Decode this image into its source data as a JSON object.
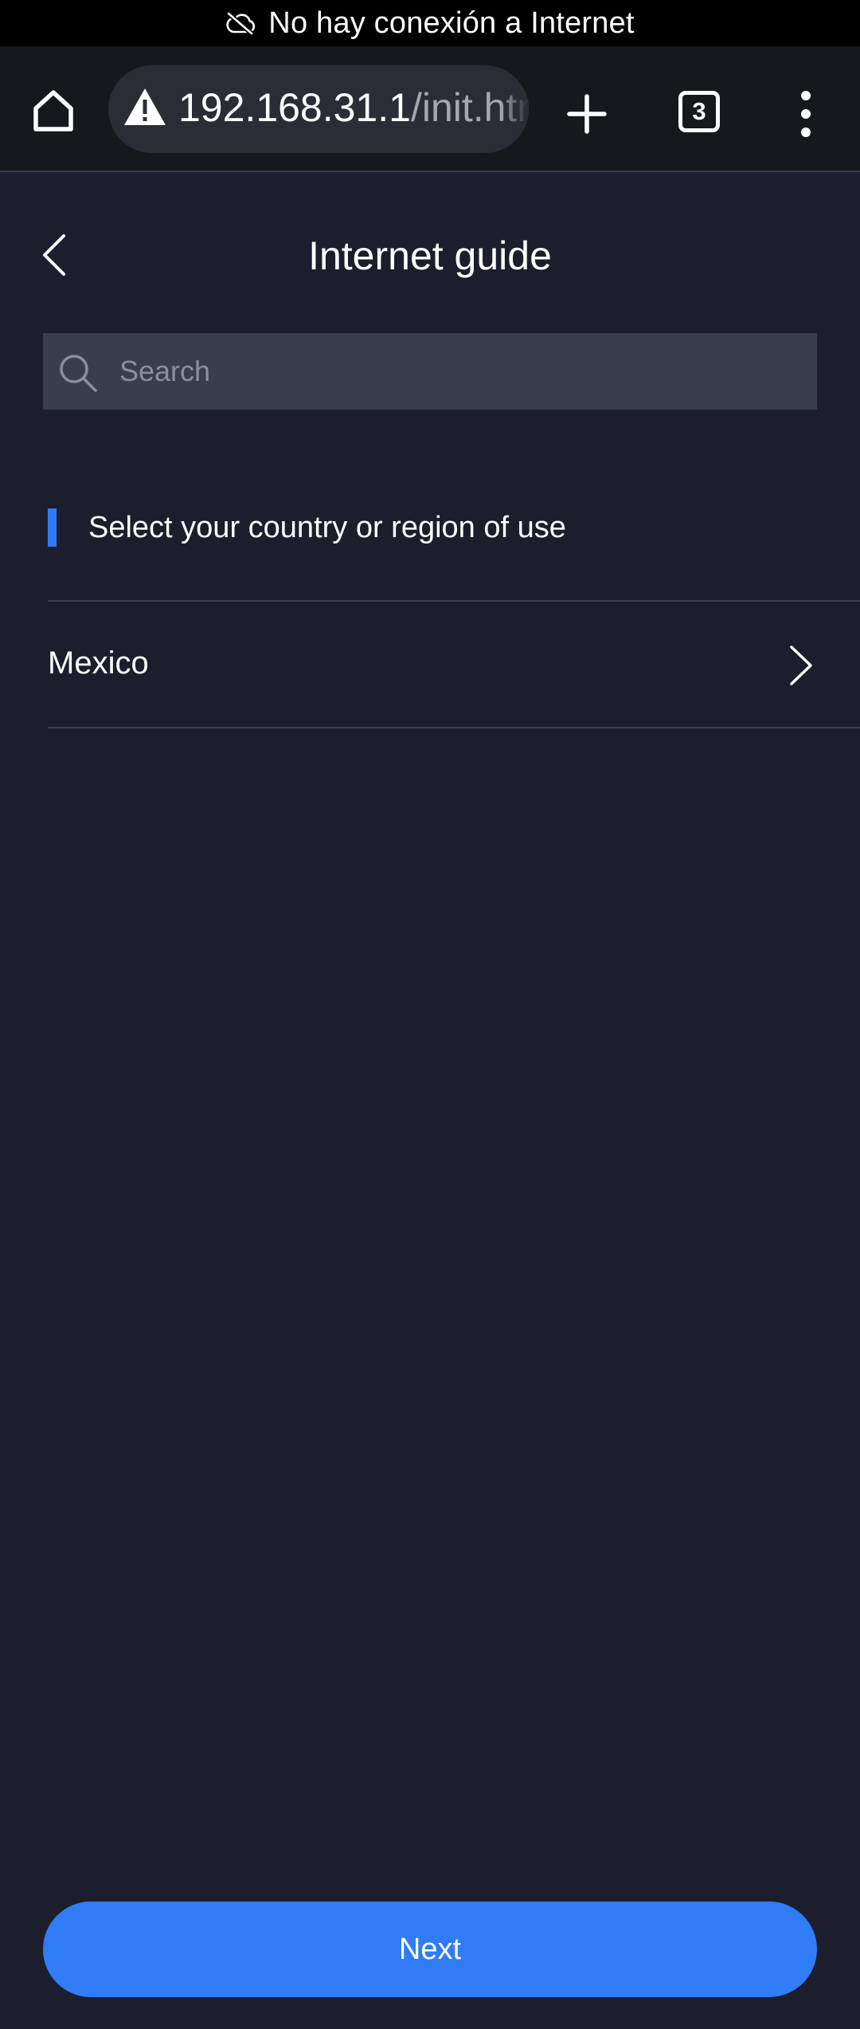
{
  "status_bar": {
    "icon": "cloud-off-icon",
    "text": "No hay conexión a Internet"
  },
  "browser": {
    "url_host": "192.168.31.1",
    "url_path": "/init.htm",
    "tab_count": "3",
    "icons": [
      "home-icon",
      "warning-icon",
      "plus-icon",
      "tab-switcher-icon",
      "more-vert-icon"
    ]
  },
  "page": {
    "title": "Internet guide",
    "search_placeholder": "Search",
    "section_title": "Select your country or region of use",
    "country": "Mexico",
    "next_label": "Next"
  },
  "colors": {
    "background": "#1c1e2d",
    "accent": "#2f7cf6",
    "search_bg": "#393e4f",
    "toolbar_bg": "#17181c"
  }
}
